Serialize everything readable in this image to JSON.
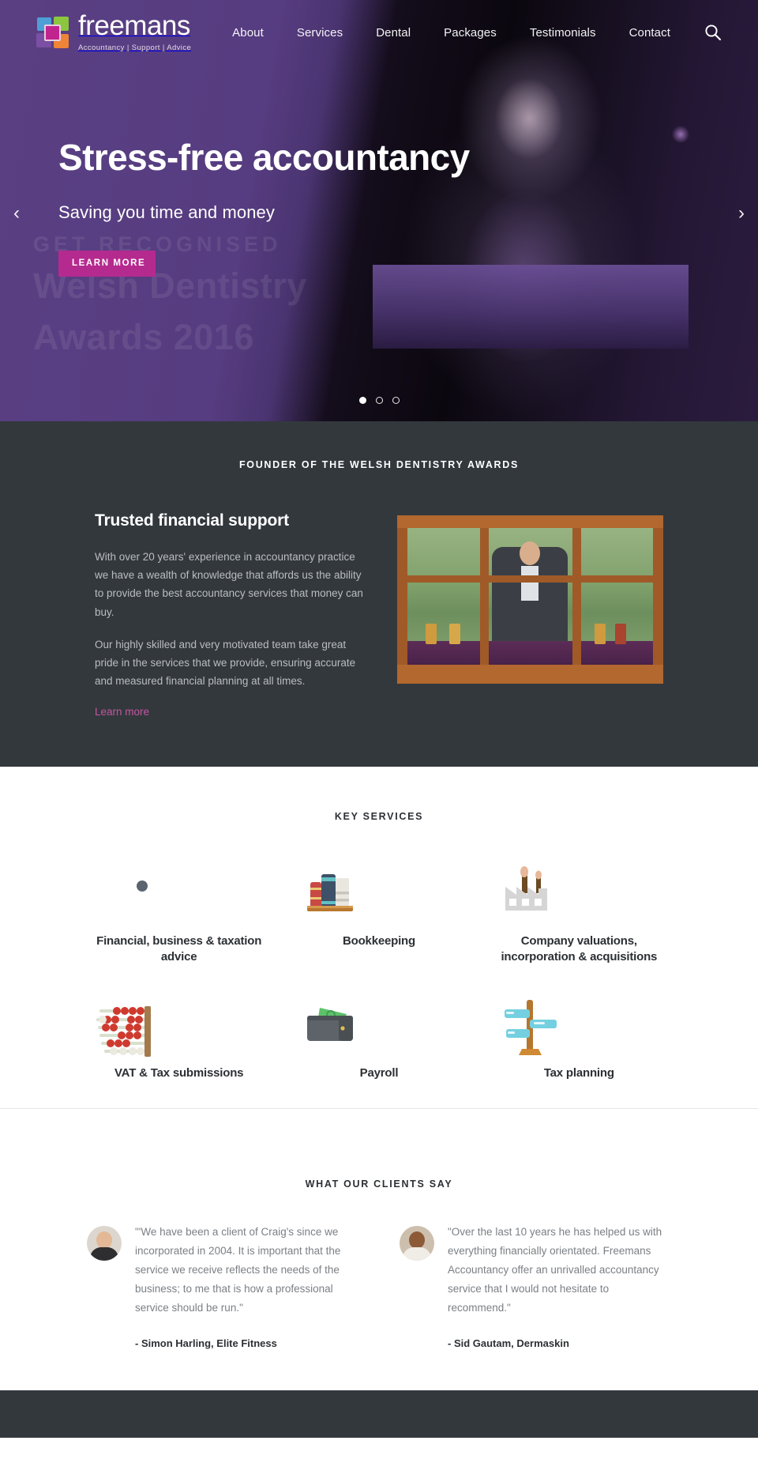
{
  "brand": {
    "name": "freemans",
    "tagline": "Accountancy | Support | Advice",
    "logo_colors": {
      "top_left": "#4e9fd6",
      "top_right": "#8cc63f",
      "bottom_left": "#7b4fa3",
      "bottom_right": "#ef8337",
      "center": "#c2248f"
    }
  },
  "nav": {
    "items": [
      {
        "label": "About"
      },
      {
        "label": "Services"
      },
      {
        "label": "Dental"
      },
      {
        "label": "Packages"
      },
      {
        "label": "Testimonials"
      },
      {
        "label": "Contact"
      }
    ],
    "search_icon": "search-icon"
  },
  "hero": {
    "title": "Stress-free accountancy",
    "subtitle": "Saving you time and money",
    "cta_label": "LEARN MORE",
    "cta_color": "#b52a8e",
    "prev_icon": "‹",
    "next_icon": "›",
    "ghost_line1": "GET RECOGNISED",
    "ghost_line2": "Welsh Dentistry",
    "ghost_line3": "Awards 2016",
    "slides": [
      {
        "active": true
      },
      {
        "active": false
      },
      {
        "active": false
      }
    ]
  },
  "about_section": {
    "eyebrow": "FOUNDER OF THE WELSH DENTISTRY AWARDS",
    "heading": "Trusted financial support",
    "paragraph1": "With over 20 years' experience in accountancy practice we have a wealth of knowledge that affords us the ability to provide the best accountancy services that money can buy.",
    "paragraph2": "Our highly skilled and very motivated team take great pride in the services that we provide, ensuring accurate and measured financial planning at all times.",
    "link_label": "Learn more",
    "link_color": "#c4569f",
    "background": "#33383d"
  },
  "services_section": {
    "title": "KEY SERVICES",
    "items": [
      {
        "label": "Financial, business & taxation advice",
        "icon": "line-chart-icon",
        "circle_color": "#5b2d82"
      },
      {
        "label": "Bookkeeping",
        "icon": "books-icon",
        "circle_color": "#8cbf3f"
      },
      {
        "label": "Company valuations, incorporation & acquisitions",
        "icon": "factory-icon",
        "circle_color": "#d4602a"
      },
      {
        "label": "VAT & Tax submissions",
        "icon": "abacus-icon",
        "circle_color": "#8cbf3f"
      },
      {
        "label": "Payroll",
        "icon": "wallet-icon",
        "circle_color": "#d4602a"
      },
      {
        "label": "Tax planning",
        "icon": "signpost-icon",
        "circle_color": "#5b2d82"
      }
    ]
  },
  "testimonials_section": {
    "title": "WHAT OUR CLIENTS SAY",
    "items": [
      {
        "quote": "\"'We have been a client of Craig's since we incorporated in 2004. It is important that the service we receive reflects the needs of the business; to me that is how a professional service should be run.\"",
        "author": "- Simon Harling, Elite Fitness"
      },
      {
        "quote": "\"Over the last 10 years he has helped us with everything financially orientated. Freemans Accountancy offer an unrivalled accountancy service that I would not hesitate to recommend.\"",
        "author": "- Sid Gautam, Dermaskin"
      }
    ]
  }
}
